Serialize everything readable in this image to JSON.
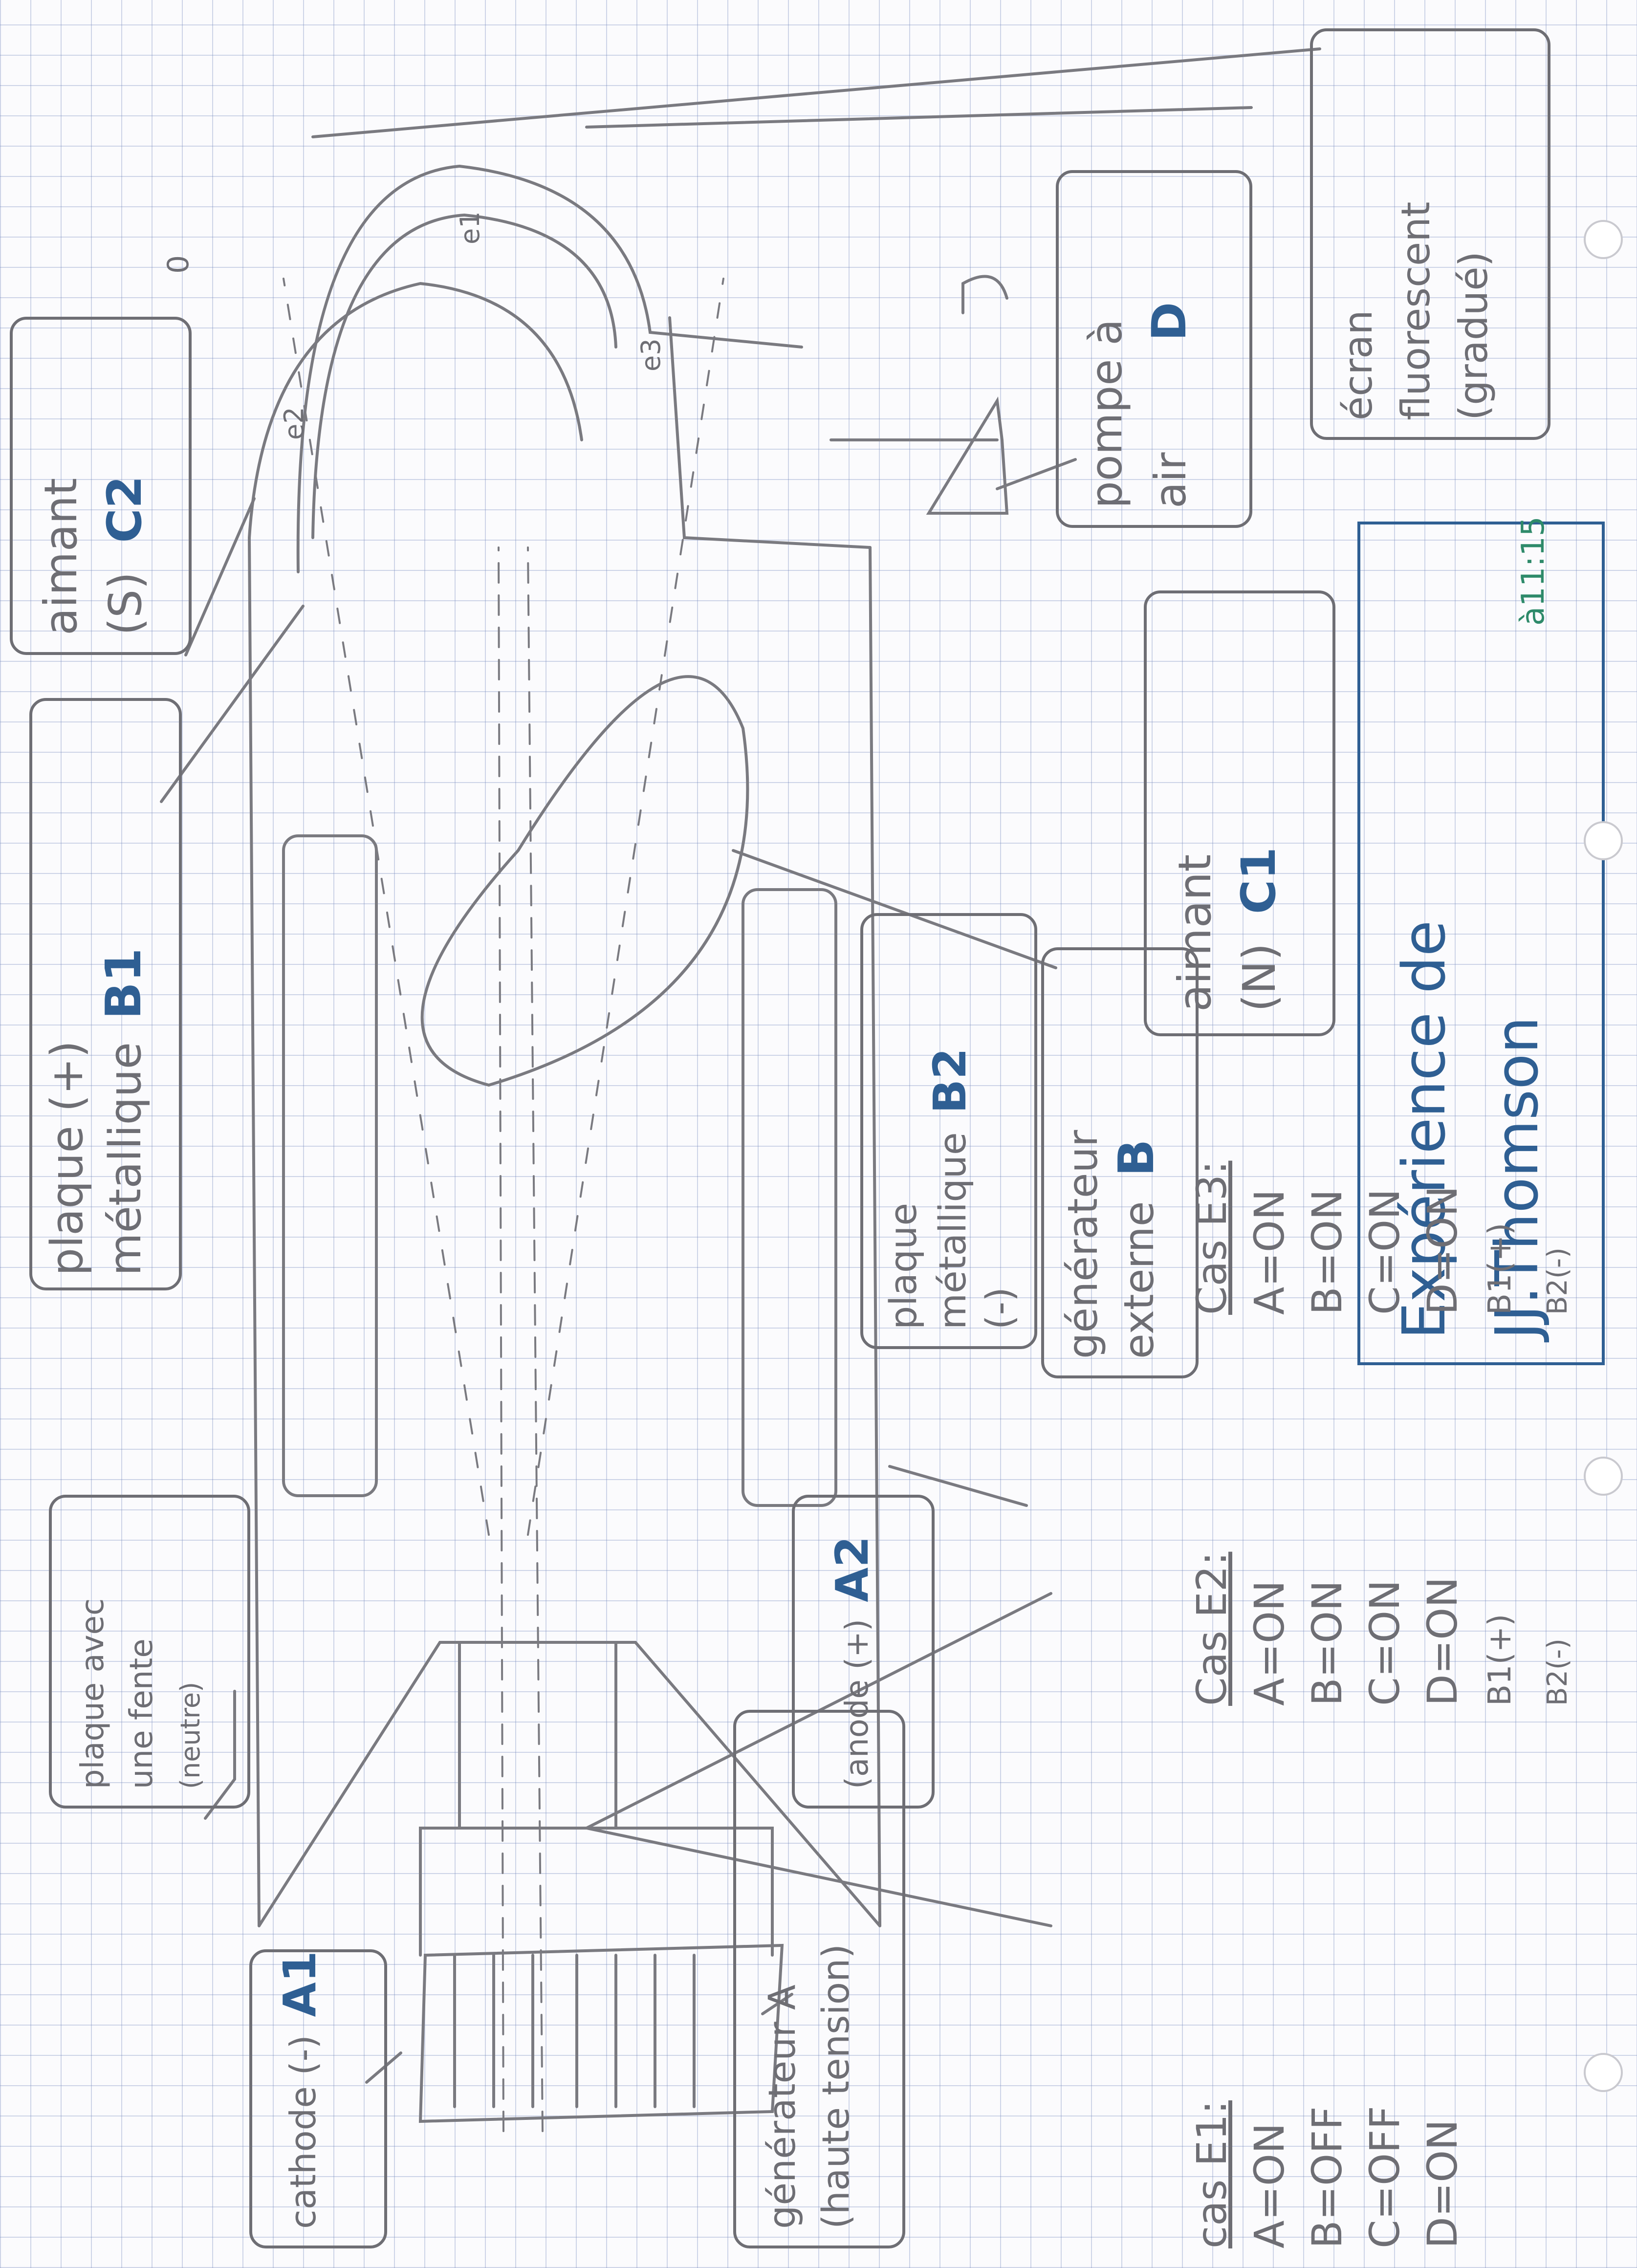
{
  "labels": {
    "a1_text": "cathode (-)",
    "a1_code": "A1",
    "a2_text": "(anode (+)",
    "a2_code": "A2",
    "generator_a_line1": "générateur A",
    "generator_a_line2": "(haute tension)",
    "plate_slit_line1": "plaque avec",
    "plate_slit_line2": "une fente",
    "plate_slit_line3": "(neutre)",
    "b1_line1": "plaque (+)",
    "b1_line2": "métallique",
    "b1_code": "B1",
    "b2_line1": "plaque",
    "b2_line2": "métallique",
    "b2_line3": "(-)",
    "b2_code": "B2",
    "generator_b_line1": "générateur",
    "generator_b_line2": "externe",
    "generator_b_code": "B",
    "magnet_s_line1": "aimant",
    "magnet_s_line2": "(S)",
    "magnet_s_code": "C2",
    "magnet_n_line1": "aimant",
    "magnet_n_line2": "(N)",
    "magnet_n_code": "C1",
    "pump_line1": "pompe à",
    "pump_line2": "air",
    "pump_code": "D",
    "screen_line1": "écran",
    "screen_line2": "fluorescent",
    "screen_line3": "(gradué)",
    "e1": "e1",
    "e2": "e2",
    "e3": "e3",
    "zero": "0"
  },
  "title": {
    "line1": "Expérience de",
    "line2": "JJ.Thomson"
  },
  "cases": {
    "cas1_title": "cas E1:",
    "cas1": [
      "A=ON",
      "B=OFF",
      "C=OFF",
      "D=ON"
    ],
    "cas2_title": "Cas E2:",
    "cas2": [
      "A=ON",
      "B=ON",
      "C=ON",
      "D=ON",
      "B1(+)",
      "B2(-)"
    ],
    "cas3_title": "Cas E3:",
    "cas3": [
      "A=ON",
      "B=ON",
      "C=ON",
      "D=ON",
      "B1(+)",
      "B2(-)"
    ]
  },
  "time": "à11:15",
  "colors": {
    "pencil": "#6e6e74",
    "ink_blue": "#2f5f93",
    "ink_green": "#2e8a6a"
  }
}
